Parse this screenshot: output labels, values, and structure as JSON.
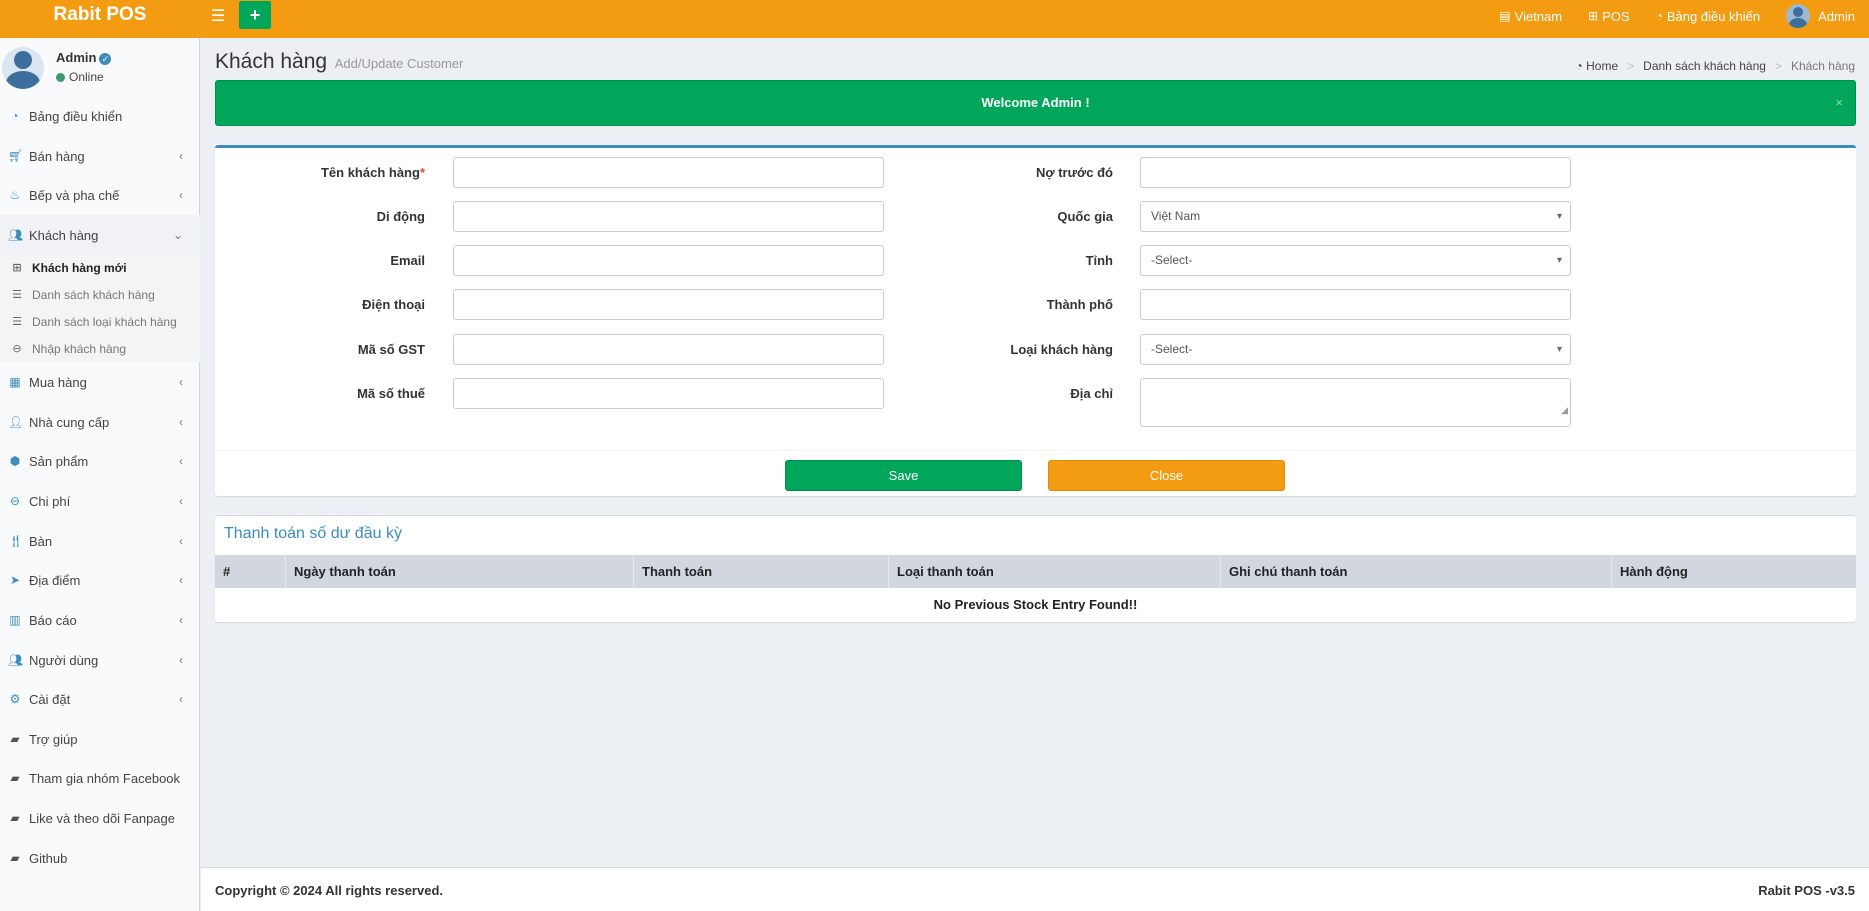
{
  "app": {
    "logo": "Rabit POS",
    "add_symbol": "+"
  },
  "topnav": {
    "language": "Vietnam",
    "pos": "POS",
    "dashboard": "Bảng điều khiển",
    "user": "Admin"
  },
  "user_panel": {
    "name": "Admin",
    "status": "Online"
  },
  "sidebar": {
    "items": [
      {
        "label": "Bảng điều khiển"
      },
      {
        "label": "Bán hàng"
      },
      {
        "label": "Bếp và pha chế"
      },
      {
        "label": "Khách hàng"
      },
      {
        "label": "Mua hàng"
      },
      {
        "label": "Nhà cung cấp"
      },
      {
        "label": "Sản phẩm"
      },
      {
        "label": "Chi phí"
      },
      {
        "label": "Bàn"
      },
      {
        "label": "Địa điểm"
      },
      {
        "label": "Báo cáo"
      },
      {
        "label": "Người dùng"
      },
      {
        "label": "Cài đặt"
      },
      {
        "label": "Trợ giúp"
      },
      {
        "label": "Tham gia nhóm Facebook"
      },
      {
        "label": "Like và theo dõi Fanpage"
      },
      {
        "label": "Github"
      }
    ],
    "subitems": [
      {
        "label": "Khách hàng mới"
      },
      {
        "label": "Danh sách khách hàng"
      },
      {
        "label": "Danh sách loại khách hàng"
      },
      {
        "label": "Nhập khách hàng"
      }
    ]
  },
  "header": {
    "title": "Khách hàng",
    "subtitle": "Add/Update Customer"
  },
  "breadcrumb": {
    "home": "Home",
    "list": "Danh sách khách hàng",
    "current": "Khách hàng"
  },
  "alert": {
    "message": "Welcome Admin !",
    "close": "×"
  },
  "form": {
    "left": [
      {
        "label": "Tên khách hàng",
        "required_mark": "*",
        "value": ""
      },
      {
        "label": "Di động",
        "value": ""
      },
      {
        "label": "Email",
        "value": ""
      },
      {
        "label": "Điện thoại",
        "value": ""
      },
      {
        "label": "Mã số GST",
        "value": ""
      },
      {
        "label": "Mã số thuế",
        "value": ""
      }
    ],
    "right": [
      {
        "label": "Nợ trước đó",
        "value": ""
      },
      {
        "label": "Quốc gia",
        "value": "Việt Nam"
      },
      {
        "label": "Tỉnh",
        "value": "-Select-"
      },
      {
        "label": "Thành phố",
        "value": ""
      },
      {
        "label": "Loại khách hàng",
        "value": "-Select-"
      },
      {
        "label": "Địa chỉ",
        "value": ""
      }
    ],
    "save_label": "Save",
    "close_label": "Close"
  },
  "payment": {
    "title": "Thanh toán số dư đầu kỳ",
    "columns": [
      "#",
      "Ngày thanh toán",
      "Thanh toán",
      "Loại thanh toán",
      "Ghi chú thanh toán",
      "Hành động"
    ],
    "empty": "No Previous Stock Entry Found!!"
  },
  "footer": {
    "copyright": "Copyright © 2024 All rights reserved.",
    "version": "Rabit POS -v3.5"
  },
  "colors": {
    "header": "#f39c12",
    "success": "#00a65a",
    "accent": "#3c8dbc",
    "sidebar_bg": "#f9fafc"
  }
}
